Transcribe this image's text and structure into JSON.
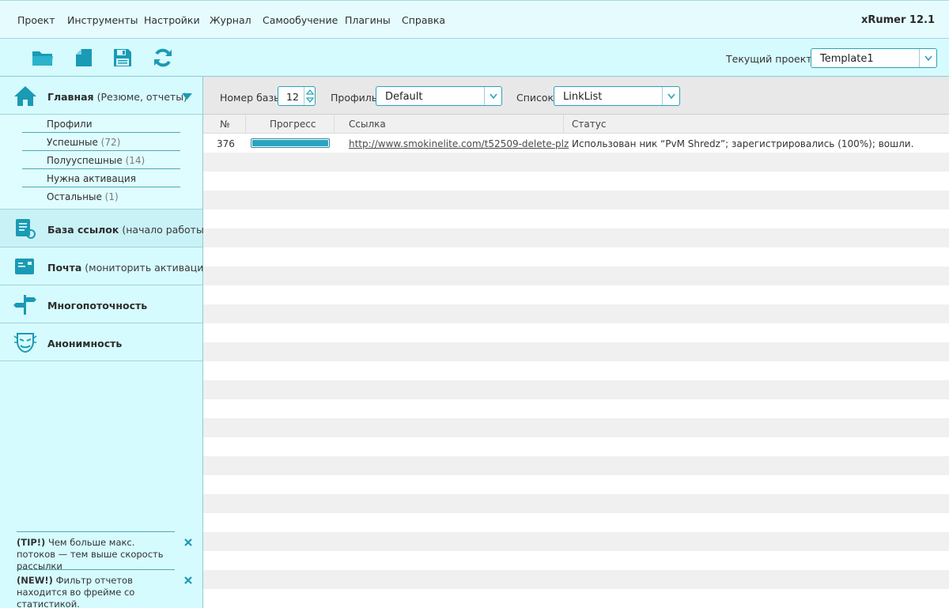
{
  "menu": {
    "items": [
      "Проект",
      "Инструменты",
      "Настройки",
      "Журнал",
      "Самообучение",
      "Плагины",
      "Справка"
    ],
    "app_version": "xRumer 12.1"
  },
  "toolbar": {
    "buttons": [
      "open-folder-icon",
      "new-file-icon",
      "save-icon",
      "refresh-icon"
    ],
    "project_label": "Текущий проект",
    "project_value": "Template1"
  },
  "sidebar": {
    "main": {
      "title": "Главная",
      "subtitle": "(Резюме, отчеты)"
    },
    "sub_items": [
      {
        "label": "Профили",
        "count": ""
      },
      {
        "label": "Успешные",
        "count": "(72)"
      },
      {
        "label": "Полууспешные",
        "count": "(14)"
      },
      {
        "label": "Нужна активация",
        "count": ""
      },
      {
        "label": "Остальные",
        "count": "(1)"
      }
    ],
    "sections": [
      {
        "title": "База ссылок",
        "subtitle": "(начало работы)",
        "icon": "link-list-icon"
      },
      {
        "title": "Почта",
        "subtitle": "(мониторить активации)",
        "icon": "mail-icon"
      },
      {
        "title": "Многопоточность",
        "subtitle": "",
        "icon": "signpost-icon"
      },
      {
        "title": "Анонимность",
        "subtitle": "",
        "icon": "mask-icon"
      }
    ],
    "tips": [
      {
        "tag": "(TIP!)",
        "text": "Чем больше макс. потоков — тем выше скорость рассылки"
      },
      {
        "tag": "(NEW!)",
        "text": "Фильтр отчетов находится во фрейме со статистикой."
      }
    ]
  },
  "filters": {
    "base_label": "Номер базы",
    "base_value": "12",
    "profile_label": "Профиль",
    "profile_value": "Default",
    "list_label": "Список",
    "list_value": "LinkList"
  },
  "table": {
    "columns": [
      "№",
      "Прогресс",
      "Ссылка",
      "Статус"
    ],
    "rows": [
      {
        "num": "376",
        "progress": 1.0,
        "link": "http://www.smokinelite.com/t52509-delete-plz",
        "status": "Использован ник “PvM Shredz”; зарегистрировались (100%); вошли."
      }
    ]
  },
  "colors": {
    "accent": "#2aa3b8",
    "sidebar_bg": "#d6fbfe",
    "menubar_bg": "#e6fbfe"
  }
}
